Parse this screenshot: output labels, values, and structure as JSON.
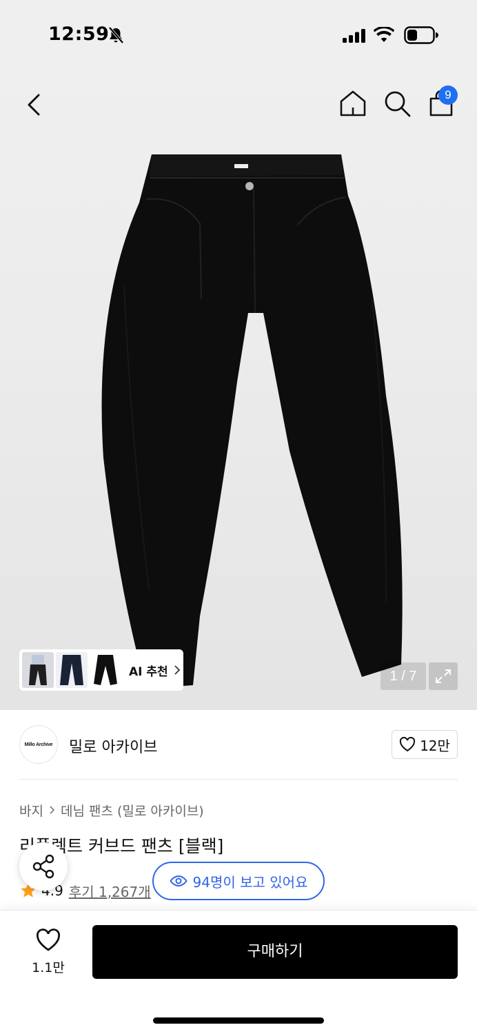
{
  "status_bar": {
    "time": "12:59",
    "icons": [
      "bell-off-icon",
      "signal-icon",
      "wifi-icon",
      "battery-icon"
    ]
  },
  "header": {
    "icons": [
      "back-icon",
      "home-icon",
      "search-icon",
      "shopping-bag-icon"
    ],
    "cart_count": "9",
    "badge_color": "#1f6ff2"
  },
  "gallery": {
    "ai_label": "AI 추천",
    "page_counter": "1 / 7",
    "current_page": 1,
    "total_pages": 7
  },
  "brand": {
    "logo_text": "Millo Archive",
    "name": "밀로 아카이브",
    "like_count": "12만"
  },
  "product": {
    "breadcrumb": [
      "바지",
      "데님 팬츠 (밀로 아카이브)"
    ],
    "title": "리플렉트 커브드 팬츠 [블랙]",
    "rating": "4.9",
    "reviews": "후기 1,267개",
    "viewers": "94명이 보고 있어요",
    "accent_color": "#2f63e8"
  },
  "bottom_bar": {
    "wish_count": "1.1만",
    "buy_label": "구매하기"
  }
}
